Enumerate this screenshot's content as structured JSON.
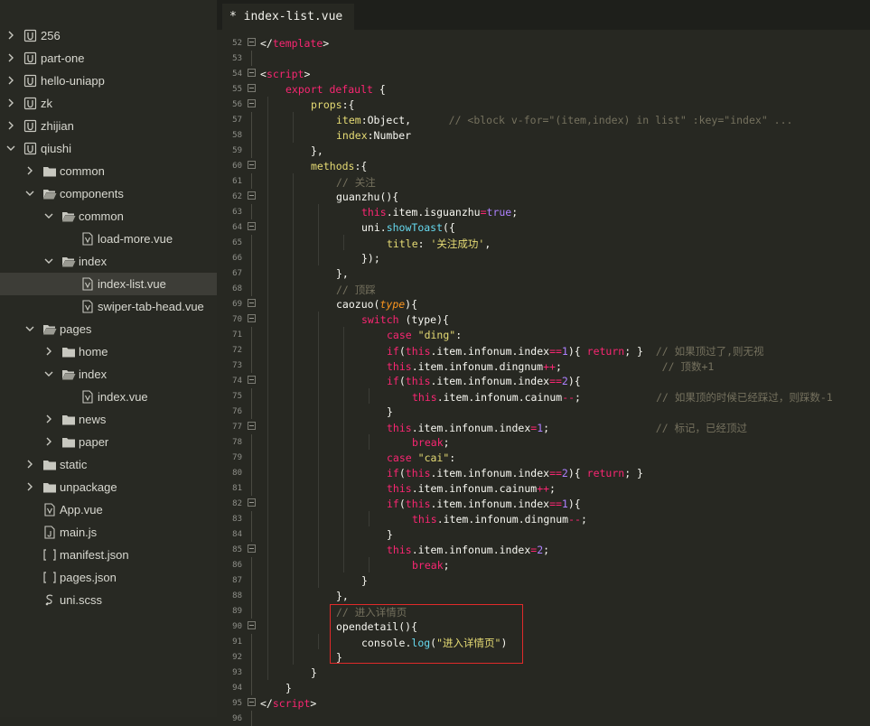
{
  "sidebar": {
    "items": [
      {
        "label": "256",
        "type": "project",
        "depth": 0,
        "expanded": false
      },
      {
        "label": "part-one",
        "type": "project",
        "depth": 0,
        "expanded": false
      },
      {
        "label": "hello-uniapp",
        "type": "project",
        "depth": 0,
        "expanded": false
      },
      {
        "label": "zk",
        "type": "project",
        "depth": 0,
        "expanded": false
      },
      {
        "label": "zhijian",
        "type": "project",
        "depth": 0,
        "expanded": false
      },
      {
        "label": "qiushi",
        "type": "project",
        "depth": 0,
        "expanded": true
      },
      {
        "label": "common",
        "type": "folder",
        "depth": 1,
        "expanded": false
      },
      {
        "label": "components",
        "type": "folder",
        "depth": 1,
        "expanded": true
      },
      {
        "label": "common",
        "type": "folder",
        "depth": 2,
        "expanded": true
      },
      {
        "label": "load-more.vue",
        "type": "vue",
        "depth": 3
      },
      {
        "label": "index",
        "type": "folder",
        "depth": 2,
        "expanded": true
      },
      {
        "label": "index-list.vue",
        "type": "vue",
        "depth": 3,
        "selected": true
      },
      {
        "label": "swiper-tab-head.vue",
        "type": "vue",
        "depth": 3
      },
      {
        "label": "pages",
        "type": "folder",
        "depth": 1,
        "expanded": true
      },
      {
        "label": "home",
        "type": "folder",
        "depth": 2,
        "expanded": false
      },
      {
        "label": "index",
        "type": "folder",
        "depth": 2,
        "expanded": true
      },
      {
        "label": "index.vue",
        "type": "vue",
        "depth": 3
      },
      {
        "label": "news",
        "type": "folder",
        "depth": 2,
        "expanded": false
      },
      {
        "label": "paper",
        "type": "folder",
        "depth": 2,
        "expanded": false
      },
      {
        "label": "static",
        "type": "folder",
        "depth": 1,
        "expanded": false
      },
      {
        "label": "unpackage",
        "type": "folder",
        "depth": 1,
        "expanded": false
      },
      {
        "label": "App.vue",
        "type": "vue",
        "depth": 1
      },
      {
        "label": "main.js",
        "type": "js",
        "depth": 1
      },
      {
        "label": "manifest.json",
        "type": "json",
        "depth": 1
      },
      {
        "label": "pages.json",
        "type": "json",
        "depth": 1
      },
      {
        "label": "uni.scss",
        "type": "scss",
        "depth": 1
      }
    ]
  },
  "tab": {
    "label": "* index-list.vue"
  },
  "editor": {
    "lines": [
      {
        "n": "52",
        "g": 0,
        "fold": true,
        "t": [
          [
            "pl",
            "</"
          ],
          [
            "tag",
            "template"
          ],
          [
            "pl",
            ">"
          ]
        ]
      },
      {
        "n": "53",
        "g": 0,
        "t": []
      },
      {
        "n": "54",
        "g": 0,
        "fold": true,
        "t": [
          [
            "pl",
            "<"
          ],
          [
            "tag",
            "script"
          ],
          [
            "pl",
            ">"
          ]
        ]
      },
      {
        "n": "55",
        "g": 1,
        "fold": true,
        "t": [
          [
            "kw",
            "export default"
          ],
          [
            "pl",
            " {"
          ]
        ]
      },
      {
        "n": "56",
        "g": 2,
        "fold": true,
        "t": [
          [
            "prop",
            "props"
          ],
          [
            "pl",
            ":{"
          ]
        ]
      },
      {
        "n": "57",
        "g": 3,
        "t": [
          [
            "prop",
            "item"
          ],
          [
            "pl",
            ":Object,      "
          ],
          [
            "cm",
            "// <block v-for=\"(item,index) in list\" :key=\"index\" ..."
          ]
        ]
      },
      {
        "n": "58",
        "g": 3,
        "t": [
          [
            "prop",
            "index"
          ],
          [
            "pl",
            ":Number"
          ]
        ]
      },
      {
        "n": "59",
        "g": 2,
        "t": [
          [
            "pl",
            "},"
          ]
        ]
      },
      {
        "n": "60",
        "g": 2,
        "fold": true,
        "t": [
          [
            "prop",
            "methods"
          ],
          [
            "pl",
            ":{"
          ]
        ]
      },
      {
        "n": "61",
        "g": 3,
        "t": [
          [
            "cm",
            "// 关注"
          ]
        ]
      },
      {
        "n": "62",
        "g": 3,
        "fold": true,
        "t": [
          [
            "pl",
            "guanzhu(){"
          ]
        ]
      },
      {
        "n": "63",
        "g": 4,
        "t": [
          [
            "kw",
            "this"
          ],
          [
            "pl",
            "."
          ],
          [
            "pl",
            "item"
          ],
          [
            "pl",
            "."
          ],
          [
            "pl",
            "isguanzhu"
          ],
          [
            "kw",
            "="
          ],
          [
            "num",
            "true"
          ],
          [
            "pl",
            ";"
          ]
        ]
      },
      {
        "n": "64",
        "g": 4,
        "fold": true,
        "t": [
          [
            "pl",
            "uni."
          ],
          [
            "fn",
            "showToast"
          ],
          [
            "pl",
            "({"
          ]
        ]
      },
      {
        "n": "65",
        "g": 5,
        "t": [
          [
            "prop",
            "title"
          ],
          [
            "pl",
            ": "
          ],
          [
            "str",
            "'关注成功'"
          ],
          [
            "pl",
            ","
          ]
        ]
      },
      {
        "n": "66",
        "g": 4,
        "t": [
          [
            "pl",
            "});"
          ]
        ]
      },
      {
        "n": "67",
        "g": 3,
        "t": [
          [
            "pl",
            "},"
          ]
        ]
      },
      {
        "n": "68",
        "g": 3,
        "t": [
          [
            "cm",
            "// 顶踩"
          ]
        ]
      },
      {
        "n": "69",
        "g": 3,
        "fold": true,
        "t": [
          [
            "pl",
            "caozuo("
          ],
          [
            "param",
            "type"
          ],
          [
            "pl",
            "){"
          ]
        ]
      },
      {
        "n": "70",
        "g": 4,
        "fold": true,
        "t": [
          [
            "kw",
            "switch"
          ],
          [
            "pl",
            " (type){"
          ]
        ]
      },
      {
        "n": "71",
        "g": 5,
        "t": [
          [
            "kw",
            "case"
          ],
          [
            "pl",
            " "
          ],
          [
            "str",
            "\"ding\""
          ],
          [
            "pl",
            ":"
          ]
        ]
      },
      {
        "n": "72",
        "g": 5,
        "t": [
          [
            "kw",
            "if"
          ],
          [
            "pl",
            "("
          ],
          [
            "kw",
            "this"
          ],
          [
            "pl",
            ".item.infonum.index"
          ],
          [
            "kw",
            "=="
          ],
          [
            "num",
            "1"
          ],
          [
            "pl",
            "){ "
          ],
          [
            "kw",
            "return"
          ],
          [
            "pl",
            "; }  "
          ],
          [
            "cm",
            "// 如果顶过了,则无视"
          ]
        ]
      },
      {
        "n": "73",
        "g": 5,
        "t": [
          [
            "kw",
            "this"
          ],
          [
            "pl",
            ".item.infonum.dingnum"
          ],
          [
            "kw",
            "++"
          ],
          [
            "pl",
            ";                "
          ],
          [
            "cm",
            "// 顶数+1"
          ]
        ]
      },
      {
        "n": "74",
        "g": 5,
        "fold": true,
        "t": [
          [
            "kw",
            "if"
          ],
          [
            "pl",
            "("
          ],
          [
            "kw",
            "this"
          ],
          [
            "pl",
            ".item.infonum.index"
          ],
          [
            "kw",
            "=="
          ],
          [
            "num",
            "2"
          ],
          [
            "pl",
            "){"
          ]
        ]
      },
      {
        "n": "75",
        "g": 6,
        "t": [
          [
            "kw",
            "this"
          ],
          [
            "pl",
            ".item.infonum.cainum"
          ],
          [
            "kw",
            "--"
          ],
          [
            "pl",
            ";            "
          ],
          [
            "cm",
            "// 如果顶的时候已经踩过，则踩数-1"
          ]
        ]
      },
      {
        "n": "76",
        "g": 5,
        "t": [
          [
            "pl",
            "}"
          ]
        ]
      },
      {
        "n": "77",
        "g": 5,
        "fold": true,
        "t": [
          [
            "kw",
            "this"
          ],
          [
            "pl",
            ".item.infonum.index"
          ],
          [
            "kw",
            "="
          ],
          [
            "num",
            "1"
          ],
          [
            "pl",
            ";                 "
          ],
          [
            "cm",
            "// 标记，已经顶过"
          ]
        ]
      },
      {
        "n": "78",
        "g": 6,
        "t": [
          [
            "kw",
            "break"
          ],
          [
            "pl",
            ";"
          ]
        ]
      },
      {
        "n": "79",
        "g": 5,
        "t": [
          [
            "kw",
            "case"
          ],
          [
            "pl",
            " "
          ],
          [
            "str",
            "\"cai\""
          ],
          [
            "pl",
            ":"
          ]
        ]
      },
      {
        "n": "80",
        "g": 5,
        "t": [
          [
            "kw",
            "if"
          ],
          [
            "pl",
            "("
          ],
          [
            "kw",
            "this"
          ],
          [
            "pl",
            ".item.infonum.index"
          ],
          [
            "kw",
            "=="
          ],
          [
            "num",
            "2"
          ],
          [
            "pl",
            "){ "
          ],
          [
            "kw",
            "return"
          ],
          [
            "pl",
            "; }"
          ]
        ]
      },
      {
        "n": "81",
        "g": 5,
        "t": [
          [
            "kw",
            "this"
          ],
          [
            "pl",
            ".item.infonum.cainum"
          ],
          [
            "kw",
            "++"
          ],
          [
            "pl",
            ";"
          ]
        ]
      },
      {
        "n": "82",
        "g": 5,
        "fold": true,
        "t": [
          [
            "kw",
            "if"
          ],
          [
            "pl",
            "("
          ],
          [
            "kw",
            "this"
          ],
          [
            "pl",
            ".item.infonum.index"
          ],
          [
            "kw",
            "=="
          ],
          [
            "num",
            "1"
          ],
          [
            "pl",
            "){"
          ]
        ]
      },
      {
        "n": "83",
        "g": 6,
        "t": [
          [
            "kw",
            "this"
          ],
          [
            "pl",
            ".item.infonum.dingnum"
          ],
          [
            "kw",
            "--"
          ],
          [
            "pl",
            ";"
          ]
        ]
      },
      {
        "n": "84",
        "g": 5,
        "t": [
          [
            "pl",
            "}"
          ]
        ]
      },
      {
        "n": "85",
        "g": 5,
        "fold": true,
        "t": [
          [
            "kw",
            "this"
          ],
          [
            "pl",
            ".item.infonum.index"
          ],
          [
            "kw",
            "="
          ],
          [
            "num",
            "2"
          ],
          [
            "pl",
            ";"
          ]
        ]
      },
      {
        "n": "86",
        "g": 6,
        "t": [
          [
            "kw",
            "break"
          ],
          [
            "pl",
            ";"
          ]
        ]
      },
      {
        "n": "87",
        "g": 4,
        "t": [
          [
            "pl",
            "}"
          ]
        ]
      },
      {
        "n": "88",
        "g": 3,
        "t": [
          [
            "pl",
            "},"
          ]
        ]
      },
      {
        "n": "89",
        "g": 3,
        "t": [
          [
            "cm",
            "// 进入详情页"
          ]
        ]
      },
      {
        "n": "90",
        "g": 3,
        "fold": true,
        "t": [
          [
            "pl",
            "opendetail(){"
          ]
        ]
      },
      {
        "n": "91",
        "g": 4,
        "t": [
          [
            "pl",
            "console."
          ],
          [
            "fn",
            "log"
          ],
          [
            "pl",
            "("
          ],
          [
            "str",
            "\"进入详情页\""
          ],
          [
            "pl",
            ")"
          ]
        ]
      },
      {
        "n": "92",
        "g": 3,
        "t": [
          [
            "pl",
            "}"
          ]
        ]
      },
      {
        "n": "93",
        "g": 2,
        "t": [
          [
            "pl",
            "}"
          ]
        ]
      },
      {
        "n": "94",
        "g": 1,
        "t": [
          [
            "pl",
            "}"
          ]
        ]
      },
      {
        "n": "95",
        "g": 0,
        "fold": true,
        "t": [
          [
            "pl",
            "</"
          ],
          [
            "tag",
            "script"
          ],
          [
            "pl",
            ">"
          ]
        ]
      },
      {
        "n": "96",
        "g": 0,
        "t": []
      }
    ]
  },
  "colors": {
    "sidebar_bg": "#282923",
    "editor_bg": "#272822",
    "selected_row": "#3d3d37",
    "highlight_border": "#e02a2a"
  }
}
